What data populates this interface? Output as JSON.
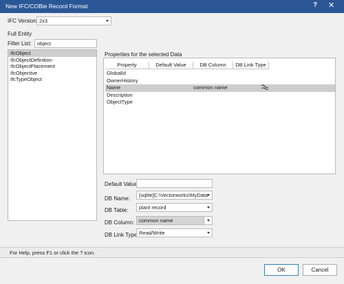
{
  "window": {
    "title": "New IFC/COBie Record Format",
    "help_glyph": "?",
    "close_glyph": "✕"
  },
  "ifc_version": {
    "label": "IFC Version:",
    "value": "2x3"
  },
  "full_entity_label": "Full Entity",
  "filter": {
    "label": "Filter List:",
    "value": "object"
  },
  "entities": [
    "IfcObject",
    "IfcObjectDefinition",
    "IfcObjectPlacement",
    "IfcObjective",
    "IfcTypeObject"
  ],
  "properties": {
    "label": "Properties for the selected Data",
    "columns": [
      "Property",
      "Default Value",
      "DB Column",
      "DB Link Type"
    ],
    "rows": [
      {
        "property": "GlobalId",
        "db_column": ""
      },
      {
        "property": "OwnerHistory",
        "db_column": ""
      },
      {
        "property": "Name",
        "db_column": "common name",
        "link_icon": "link-icon"
      },
      {
        "property": "Description",
        "db_column": ""
      },
      {
        "property": "ObjectType",
        "db_column": ""
      }
    ]
  },
  "form": {
    "default_value_label": "Default Value:",
    "default_value": "",
    "db_name_label": "DB Name:",
    "db_name_value": "[sqlite]C:\\Vectorworks\\MyData",
    "db_table_label": "DB Table:",
    "db_table_value": "plant record",
    "db_column_label": "DB Column:",
    "db_column_value": "common name",
    "db_link_type_label": "DB Link Type:",
    "db_link_type_value": "Read/Write"
  },
  "status": "For Help, press F1 or click the ? icon.",
  "buttons": {
    "ok": "OK",
    "cancel": "Cancel"
  }
}
